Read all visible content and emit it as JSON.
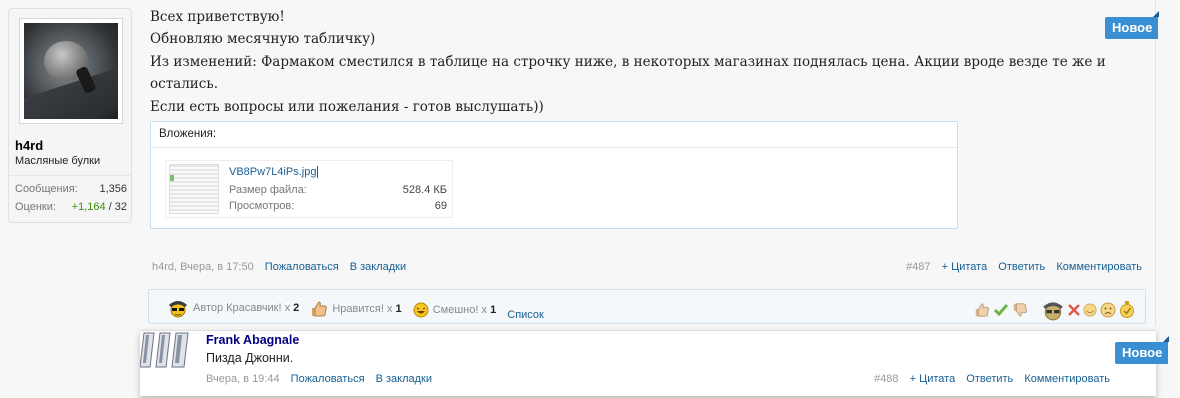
{
  "post1": {
    "user": {
      "name": "h4rd",
      "title": "Масляные булки",
      "messages_label": "Сообщения:",
      "messages_value": "1,356",
      "ratings_label": "Оценки:",
      "ratings_positive": "+1,164",
      "ratings_rest": " / 32"
    },
    "message_lines": [
      "Всех приветствую!",
      "Обновляю месячную табличку)",
      "Из изменений: Фармаком сместился в таблице на строчку ниже, в некоторых магазинах поднялась цена. Акции вроде везде те же и",
      "остались.",
      "Если есть вопросы или пожелания - готов выслушать))"
    ],
    "badge": "Новое",
    "attachments": {
      "header": "Вложения:",
      "file_name": "VB8Pw7L4iPs.jpg",
      "size_label": "Размер файла:",
      "size_value": "528.4 КБ",
      "views_label": "Просмотров:",
      "views_value": "69"
    },
    "meta": {
      "author_time": "h4rd, Вчера, в 17:50",
      "report": "Пожаловаться",
      "bookmark": "В закладки",
      "post_number": "#487",
      "quote": "+ Цитата",
      "reply": "Ответить",
      "comment": "Комментировать"
    },
    "ratings_bar": {
      "r1_label": "Автор Красавчик!",
      "r1_count": "2",
      "r2_label": "Нравится!",
      "r2_count": "1",
      "r3_label": "Смешно!",
      "r3_count": "1",
      "x": "x",
      "list_link": "Список"
    }
  },
  "post2": {
    "name": "Frank Abagnale",
    "message": "Пизда Джонни.",
    "badge": "Новое",
    "meta": {
      "time": "Вчера, в 19:44",
      "report": "Пожаловаться",
      "bookmark": "В закладки",
      "post_number": "#488",
      "quote": "+ Цитата",
      "reply": "Ответить",
      "comment": "Комментировать"
    }
  },
  "colors": {
    "link": "#176093",
    "badge": "#3a8fd3",
    "positive": "#3d8f0d",
    "username2": "#000080"
  }
}
